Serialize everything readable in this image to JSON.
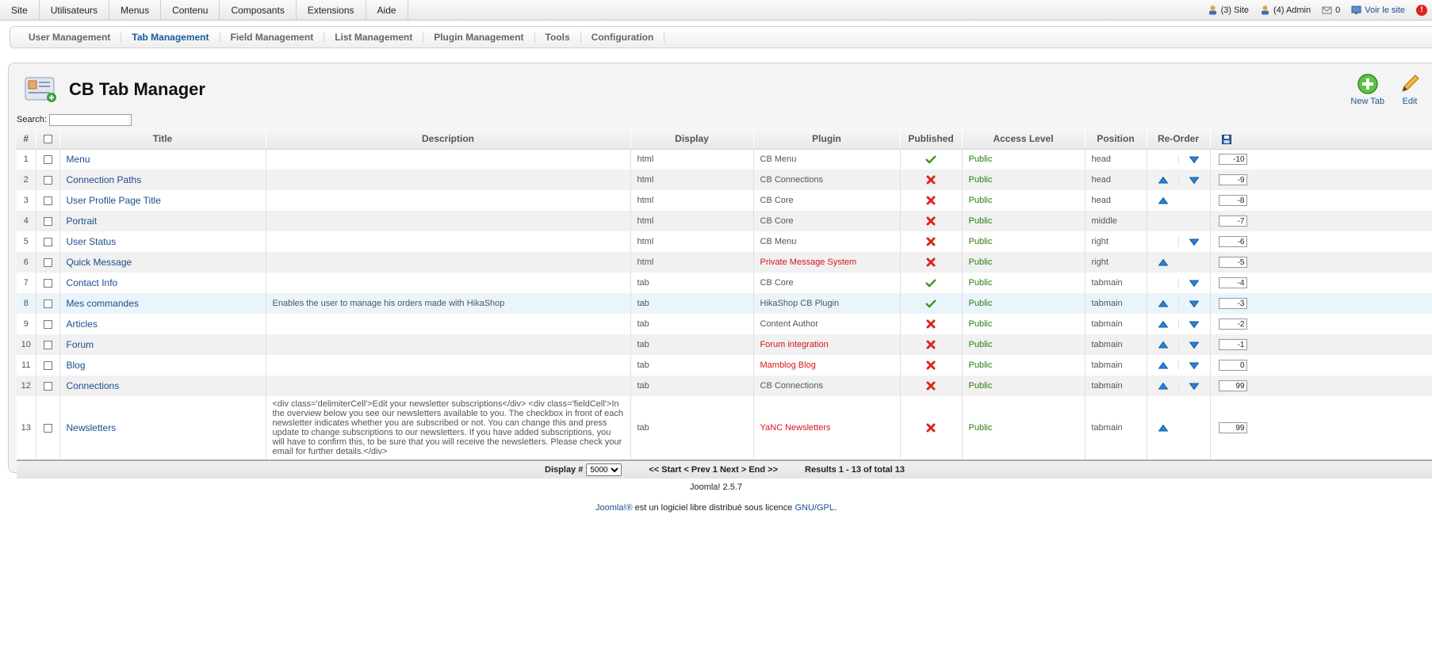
{
  "top_menu": [
    "Site",
    "Utilisateurs",
    "Menus",
    "Contenu",
    "Composants",
    "Extensions",
    "Aide"
  ],
  "status": {
    "site_users": "(3) Site",
    "admin_users": "(4) Admin",
    "messages": "0",
    "view_site": "Voir le site"
  },
  "sub_menu": [
    {
      "label": "User Management",
      "active": false
    },
    {
      "label": "Tab Management",
      "active": true
    },
    {
      "label": "Field Management",
      "active": false
    },
    {
      "label": "List Management",
      "active": false
    },
    {
      "label": "Plugin Management",
      "active": false
    },
    {
      "label": "Tools",
      "active": false
    },
    {
      "label": "Configuration",
      "active": false
    }
  ],
  "page_title": "CB Tab Manager",
  "toolbar": {
    "new_tab": "New Tab",
    "edit": "Edit"
  },
  "search": {
    "label": "Search:",
    "value": ""
  },
  "columns": {
    "num": "#",
    "title": "Title",
    "description": "Description",
    "display": "Display",
    "plugin": "Plugin",
    "published": "Published",
    "access": "Access Level",
    "position": "Position",
    "reorder": "Re-Order"
  },
  "rows": [
    {
      "num": "1",
      "title": "Menu",
      "description": "",
      "display": "html",
      "plugin": "CB Menu",
      "plugin_missing": false,
      "published": true,
      "access": "Public",
      "position": "head",
      "up": false,
      "down": true,
      "order": "-10"
    },
    {
      "num": "2",
      "title": "Connection Paths",
      "description": "",
      "display": "html",
      "plugin": "CB Connections",
      "plugin_missing": false,
      "published": false,
      "access": "Public",
      "position": "head",
      "up": true,
      "down": true,
      "order": "-9"
    },
    {
      "num": "3",
      "title": "User Profile Page Title",
      "description": "",
      "display": "html",
      "plugin": "CB Core",
      "plugin_missing": false,
      "published": false,
      "access": "Public",
      "position": "head",
      "up": true,
      "down": false,
      "order": "-8"
    },
    {
      "num": "4",
      "title": "Portrait",
      "description": "",
      "display": "html",
      "plugin": "CB Core",
      "plugin_missing": false,
      "published": false,
      "access": "Public",
      "position": "middle",
      "up": false,
      "down": false,
      "order": "-7"
    },
    {
      "num": "5",
      "title": "User Status",
      "description": "",
      "display": "html",
      "plugin": "CB Menu",
      "plugin_missing": false,
      "published": false,
      "access": "Public",
      "position": "right",
      "up": false,
      "down": true,
      "order": "-6"
    },
    {
      "num": "6",
      "title": "Quick Message",
      "description": "",
      "display": "html",
      "plugin": "Private Message System",
      "plugin_missing": true,
      "published": false,
      "access": "Public",
      "position": "right",
      "up": true,
      "down": false,
      "order": "-5"
    },
    {
      "num": "7",
      "title": "Contact Info",
      "description": "",
      "display": "tab",
      "plugin": "CB Core",
      "plugin_missing": false,
      "published": true,
      "access": "Public",
      "position": "tabmain",
      "up": false,
      "down": true,
      "order": "-4"
    },
    {
      "num": "8",
      "title": "Mes commandes",
      "description": "Enables the user to manage his orders made with HikaShop",
      "display": "tab",
      "plugin": "HikaShop CB Plugin",
      "plugin_missing": false,
      "published": true,
      "access": "Public",
      "position": "tabmain",
      "up": true,
      "down": true,
      "order": "-3",
      "highlight": true
    },
    {
      "num": "9",
      "title": "Articles",
      "description": "",
      "display": "tab",
      "plugin": "Content Author",
      "plugin_missing": false,
      "published": false,
      "access": "Public",
      "position": "tabmain",
      "up": true,
      "down": true,
      "order": "-2"
    },
    {
      "num": "10",
      "title": "Forum",
      "description": "",
      "display": "tab",
      "plugin": "Forum integration",
      "plugin_missing": true,
      "published": false,
      "access": "Public",
      "position": "tabmain",
      "up": true,
      "down": true,
      "order": "-1"
    },
    {
      "num": "11",
      "title": "Blog",
      "description": "",
      "display": "tab",
      "plugin": "Mamblog Blog",
      "plugin_missing": true,
      "published": false,
      "access": "Public",
      "position": "tabmain",
      "up": true,
      "down": true,
      "order": "0"
    },
    {
      "num": "12",
      "title": "Connections",
      "description": "",
      "display": "tab",
      "plugin": "CB Connections",
      "plugin_missing": false,
      "published": false,
      "access": "Public",
      "position": "tabmain",
      "up": true,
      "down": true,
      "order": "99"
    },
    {
      "num": "13",
      "title": "Newsletters",
      "description": "<div class='delimiterCell'>Edit your newsletter subscriptions</div> <div class='fieldCell'>In the overview below you see our newsletters available to you. The checkbox in front of each newsletter indicates whether you are subscribed or not. You can change this and press update to change subscriptions to our newsletters. If you have added subscriptions, you will have to confirm this, to be sure that you will receive the newsletters. Please check your email for further details.</div>",
      "display": "tab",
      "plugin": "YaNC Newsletters",
      "plugin_missing": true,
      "published": false,
      "access": "Public",
      "position": "tabmain",
      "up": true,
      "down": false,
      "order": "99",
      "tall": true
    }
  ],
  "pagination": {
    "display_label": "Display #",
    "display_value": "5000",
    "nav": "<< Start < Prev 1 Next > End >>",
    "results": "Results 1 - 13 of total 13"
  },
  "footer": {
    "version": "Joomla! 2.5.7",
    "license_link": "Joomla!®",
    "license_text": " est un logiciel libre distribué sous licence ",
    "license_gpl": "GNU/GPL",
    "license_end": "."
  },
  "colors": {
    "link": "#1a4d8c",
    "active_tab": "#1a5a9a",
    "plugin_missing": "#d8141b",
    "public": "#2c7a13",
    "highlight_row": "#eaf5fb"
  }
}
